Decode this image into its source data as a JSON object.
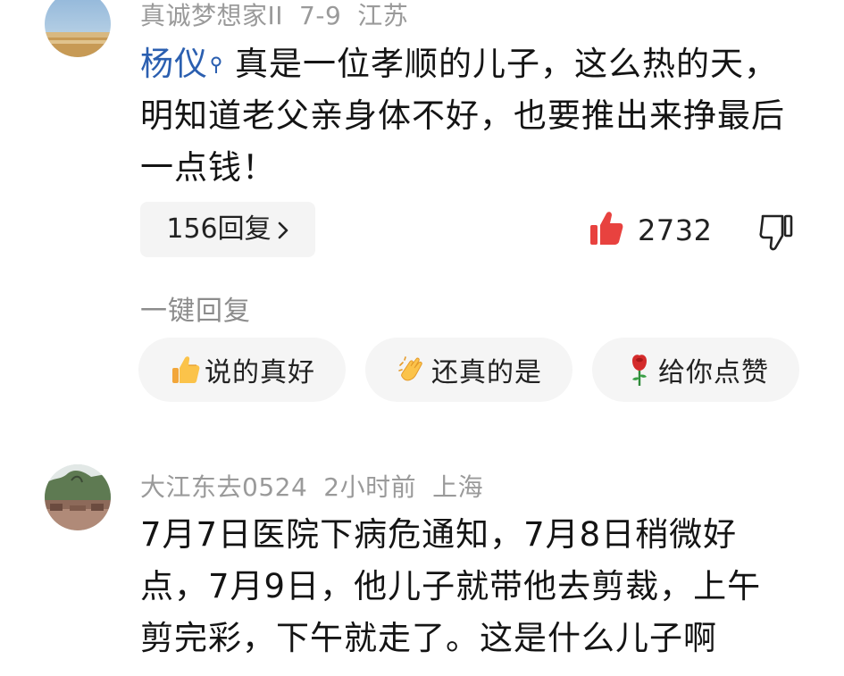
{
  "comment1": {
    "username": "真诚梦想家II",
    "date": "7-9",
    "location": "江苏",
    "mention": "杨仪",
    "mention_icon": "search-person-icon",
    "text": "真是一位孝顺的儿子，这么热的天，明知道老父亲身体不好，也要推出来挣最后一点钱！",
    "replies_label": "156回复",
    "like_count": "2732"
  },
  "quick_reply": {
    "label": "一键回复",
    "options": [
      {
        "icon": "thumbs-up-emoji",
        "text": "说的真好"
      },
      {
        "icon": "clapping-hands-emoji",
        "text": "还真的是"
      },
      {
        "icon": "rose-emoji",
        "text": "给你点赞"
      }
    ]
  },
  "comment2": {
    "username": "大江东去0524",
    "time": "2小时前",
    "location": "上海",
    "text": "7月7日医院下病危通知，7月8日稍微好点，7月9日，他儿子就带他去剪裁，上午剪完彩，下午就走了。这是什么儿子啊"
  },
  "colors": {
    "mention": "#2b5fb0",
    "like": "#e8423f",
    "meta": "#9a9a9a",
    "chip_bg": "#f5f5f5"
  }
}
